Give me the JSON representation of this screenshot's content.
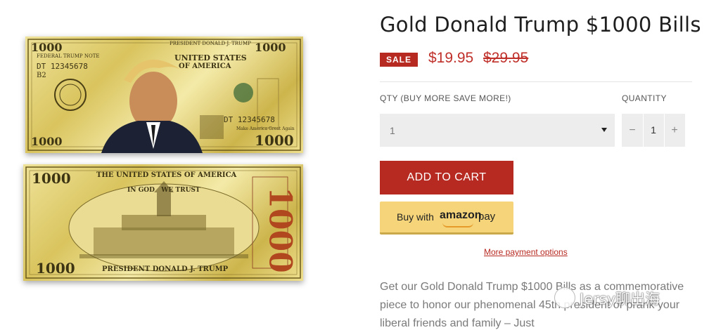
{
  "images": {
    "front": {
      "denomination": "1000",
      "top_banner": "PRESIDENT DONALD J. TRUMP",
      "country": "UNITED STATES",
      "country_line2": "OF AMERICA",
      "federal_note": "FEDERAL TRUMP NOTE",
      "serial": "DT 12345678",
      "series": "B2",
      "slogan": "Make America Great Again"
    },
    "back": {
      "denomination": "1000",
      "top_banner": "THE UNITED STATES OF AMERICA",
      "motto": "IN GOD   WE TRUST",
      "bottom_banner": "PRESIDENT DONALD J. TRUMP"
    }
  },
  "product": {
    "title": "Gold Donald Trump $1000 Bills",
    "sale_badge": "SALE",
    "price": "$19.95",
    "compare_price": "$29.95"
  },
  "form": {
    "qty_select_label": "QTY (BUY MORE SAVE MORE!)",
    "qty_select_value": "1",
    "quantity_label": "QUANTITY",
    "quantity_value": "1",
    "minus": "−",
    "plus": "+",
    "add_to_cart": "ADD TO CART",
    "amazon_buy": "Buy with",
    "amazon_brand": "amazon",
    "amazon_pay": "pay",
    "more_payment": "More payment options"
  },
  "description": "Get our Gold Donald Trump $1000 Bills as a commemorative piece to honor our phenomenal 45th president or prank your liberal friends and family – Just",
  "watermark": "Jersy聊出海",
  "colors": {
    "accent": "#b72a22",
    "amazon": "#f6d57a",
    "gold": "#e3d27a"
  }
}
